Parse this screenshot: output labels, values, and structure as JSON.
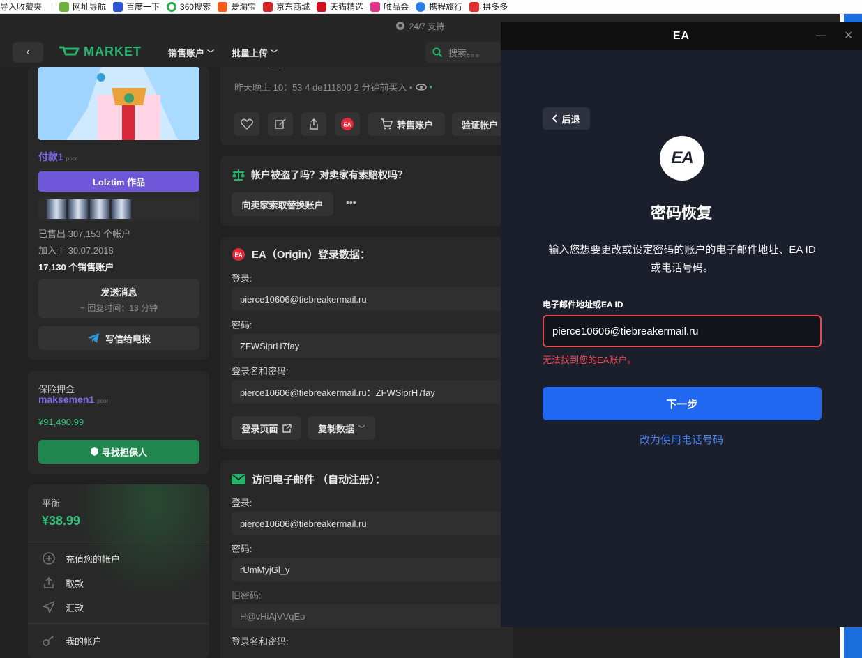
{
  "bookmarks": [
    {
      "label": "导入收藏夹",
      "color": ""
    },
    {
      "label": "网址导航",
      "color": "#6bb23b"
    },
    {
      "label": "百度一下",
      "color": "#2b55d4"
    },
    {
      "label": "360搜索",
      "color": "#2cae4a"
    },
    {
      "label": "爱淘宝",
      "color": "#f25a1d"
    },
    {
      "label": "京东商城",
      "color": "#d6242b"
    },
    {
      "label": "天猫精选",
      "color": "#d10f1f"
    },
    {
      "label": "唯品会",
      "color": "#e5318e"
    },
    {
      "label": "携程旅行",
      "color": "#2a7fe6"
    },
    {
      "label": "拼多多",
      "color": "#e22e2e"
    }
  ],
  "support": "24/7 支持",
  "nav": {
    "back": "‹",
    "logo": "MARKET",
    "sell": "销售账户",
    "bulk": "批量上传",
    "search_placeholder": "搜索。。。"
  },
  "seller": {
    "name": "付款1",
    "tag": "poor",
    "banner": "Lolztim 作品",
    "sold": "已售出 307,153 个帐户",
    "joined": "加入于 30.07.2018",
    "selling": "17,130 个销售账户",
    "message": "发送消息",
    "reply_time": "~ 回复时间：13 分钟",
    "telegram": "写信给电报"
  },
  "guarantee": {
    "title": "保险押金",
    "user": "maksemen1",
    "tag": "poor",
    "amount": "¥91,490.99",
    "button": "寻找担保人"
  },
  "balance": {
    "label": "平衡",
    "value": "¥38.99",
    "menu": [
      "充值您的帐户",
      "取款",
      "汇款",
      "我的帐户"
    ]
  },
  "purchase": {
    "dash": "—",
    "info": "昨天晚上 10：53 4 de111800 2 分钟前买入 •",
    "resell": "转售账户",
    "verify": "验证帐户"
  },
  "stolen": {
    "question": "帐户被盗了吗？对卖家有索赔权吗？",
    "request": "向卖家索取替换账户",
    "more": "•••"
  },
  "ea_login": {
    "title": "EA（Origin）登录数据：",
    "login_label": "登录:",
    "login": "pierce10606@tiebreakermail.ru",
    "password_label": "密码:",
    "password": "ZFWSiprH7fay",
    "combo_label": "登录名和密码:",
    "combo": "pierce10606@tiebreakermail.ru：ZFWSiprH7fay",
    "login_page": "登录页面",
    "copy": "复制数据"
  },
  "email_access": {
    "title": "访问电子邮件 （自动注册）：",
    "login_label": "登录:",
    "login": "pierce10606@tiebreakermail.ru",
    "password_label": "密码:",
    "password": "rUmMyjGl_y",
    "old_password_label": "旧密码:",
    "old_password": "H@vHiAjVVqEo",
    "combo_label": "登录名和密码:"
  },
  "ea_modal": {
    "title": "EA",
    "back": "后退",
    "logo": "EA",
    "heading": "密码恢复",
    "description": "输入您想要更改或设定密码的账户的电子邮件地址、EA ID 或电话号码。",
    "field_label": "电子邮件地址或EA ID",
    "field_value": "pierce10606@tiebreakermail.ru",
    "error": "无法找到您的EA账户。",
    "next": "下一步",
    "use_phone": "改为使用电话号码"
  }
}
